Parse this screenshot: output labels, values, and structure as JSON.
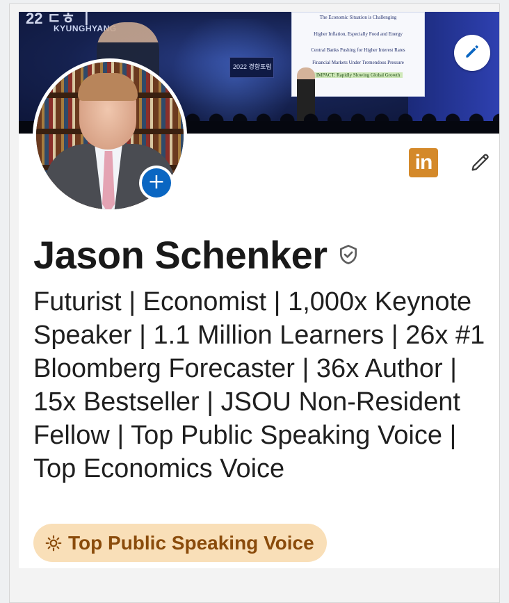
{
  "banner": {
    "event_label": "KYUNGHYANG",
    "event_logo_text": "2022 경향포럼",
    "slide_lines": [
      "The Economic Situation is Challenging",
      "Higher Inflation, Especially Food and Energy",
      "Central Banks Pushing for Higher Interest Rates",
      "Financial Markets Under Tremendous Pressure",
      "IMPACT: Rapidly Slowing Global Growth"
    ]
  },
  "profile": {
    "name": "Jason Schenker",
    "headline": "Futurist | Economist | 1,000x Keynote Speaker | 1.1 Million Learners | 26x #1 Bloomberg Forecaster | 36x Author | 15x Bestseller | JSOU Non-Resident Fellow | Top Public Speaking Voice | Top Economics Voice",
    "badge": "Top Public Speaking Voice",
    "linkedin_logo_text": "in"
  },
  "colors": {
    "accent_blue": "#0a66c2",
    "badge_bg": "#f9dfb8",
    "badge_text": "#8a4b0b",
    "linkedin_badge": "#d4892a"
  },
  "icons": {
    "banner_edit": "pencil-icon",
    "add_photo": "plus-icon",
    "profile_edit": "pencil-icon",
    "verified": "shield-check-icon",
    "badge": "lightbulb-icon"
  }
}
